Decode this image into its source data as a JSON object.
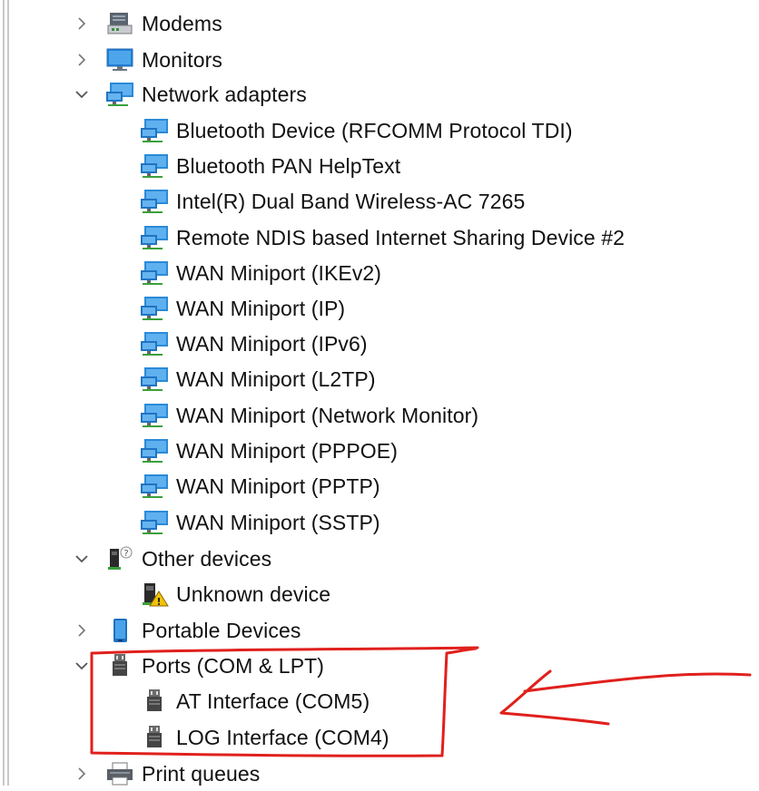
{
  "tree": {
    "categories": [
      {
        "label": "Modems",
        "expanded": false,
        "icon": "modem-icon"
      },
      {
        "label": "Monitors",
        "expanded": false,
        "icon": "monitor-icon"
      },
      {
        "label": "Network adapters",
        "expanded": true,
        "icon": "network-adapter-icon",
        "children": [
          "Bluetooth Device (RFCOMM Protocol TDI)",
          "Bluetooth PAN HelpText",
          "Intel(R) Dual Band Wireless-AC 7265",
          "Remote NDIS based Internet Sharing Device #2",
          "WAN Miniport (IKEv2)",
          "WAN Miniport (IP)",
          "WAN Miniport (IPv6)",
          "WAN Miniport (L2TP)",
          "WAN Miniport (Network Monitor)",
          "WAN Miniport (PPPOE)",
          "WAN Miniport (PPTP)",
          "WAN Miniport (SSTP)"
        ]
      },
      {
        "label": "Other devices",
        "expanded": true,
        "icon": "unknown-device-category-icon",
        "children": [
          "Unknown device"
        ]
      },
      {
        "label": "Portable Devices",
        "expanded": false,
        "icon": "portable-device-icon"
      },
      {
        "label": "Ports (COM & LPT)",
        "expanded": true,
        "icon": "port-icon",
        "children": [
          "AT Interface (COM5)",
          "LOG Interface (COM4)"
        ]
      },
      {
        "label": "Print queues",
        "expanded": false,
        "icon": "printer-icon"
      }
    ]
  },
  "annotation": {
    "color": "#e0201c",
    "shape": "hand-drawn box with arrow"
  }
}
